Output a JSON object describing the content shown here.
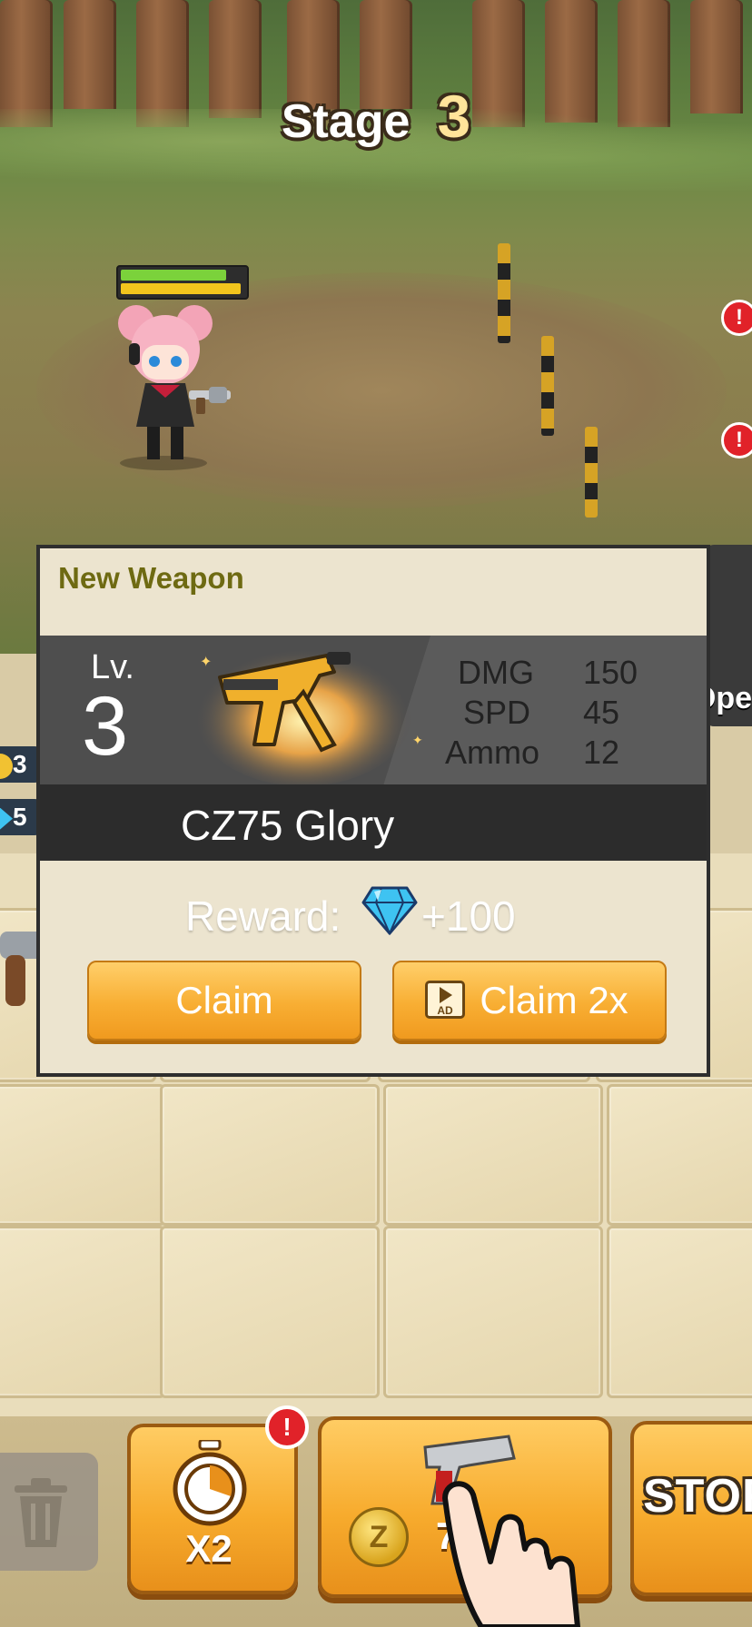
{
  "stage": {
    "label": "Stage",
    "number": "3"
  },
  "player": {
    "health_fraction": 0.88,
    "energy_fraction": 1.0
  },
  "left_resources": [
    {
      "value": "3",
      "icon": "gold-coin-icon"
    },
    {
      "value": "5",
      "icon": "gem-icon"
    }
  ],
  "right_side": {
    "open_text": "Ope"
  },
  "modal": {
    "title": "New Weapon",
    "level_label": "Lv.",
    "level_value": "3",
    "stats": [
      {
        "key": "DMG",
        "value": "150"
      },
      {
        "key": "SPD",
        "value": "45"
      },
      {
        "key": "Ammo",
        "value": "12"
      }
    ],
    "weapon_name": "CZ75 Glory",
    "reward_label": "Reward:",
    "reward_value": "+100",
    "reward_icon": "diamond-icon",
    "claim_label": "Claim",
    "claim2x_label": "Claim 2x",
    "ad_icon_text": "AD"
  },
  "bottom_bar": {
    "speed_label": "X2",
    "buy_price": "7K",
    "buy_coin_letter": "Z",
    "store_label": "STOR",
    "alert_mark": "!"
  },
  "colors": {
    "accent_orange": "#f7ab2d",
    "alert_red": "#e12229",
    "modal_title": "#6e6a12",
    "gem_blue": "#3ec3f2"
  }
}
